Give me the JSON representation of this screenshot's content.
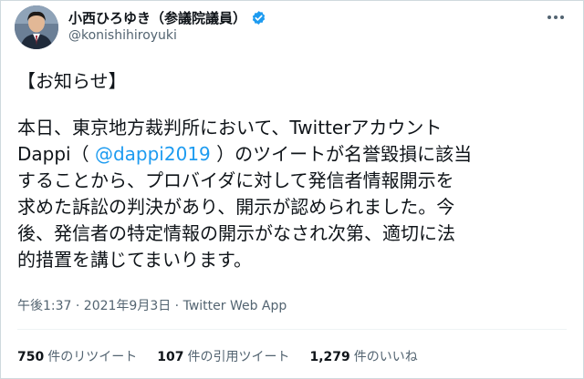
{
  "author": {
    "display_name": "小西ひろゆき（参議院議員）",
    "handle": "@konishihiroyuki",
    "verified": true
  },
  "tweet": {
    "heading": "【お知らせ】",
    "line1": "本日、東京地方裁判所において、Twitterアカウント",
    "line2_prefix": "Dappi（ ",
    "mention": "@dappi2019",
    "line2_suffix": " ）のツイートが名誉毀損に該当",
    "line3": "することから、プロバイダに対して発信者情報開示を",
    "line4": "求めた訴訟の判決があり、開示が認められました。今",
    "line5": "後、発信者の特定情報の開示がなされ次第、適切に法",
    "line6": "的措置を講じてまいります。"
  },
  "meta": {
    "timestamp": "午後1:37 · 2021年9月3日 · Twitter Web App"
  },
  "stats": {
    "retweets_count": "750",
    "retweets_label": "件のリツイート",
    "quotes_count": "107",
    "quotes_label": "件の引用ツイート",
    "likes_count": "1,279",
    "likes_label": "件のいいね"
  },
  "colors": {
    "accent": "#1d9bf0",
    "text": "#0f1419",
    "secondary": "#536471",
    "border": "#cfd9de"
  },
  "icons": {
    "verified": "verified-badge-icon",
    "more": "more-options-icon"
  }
}
